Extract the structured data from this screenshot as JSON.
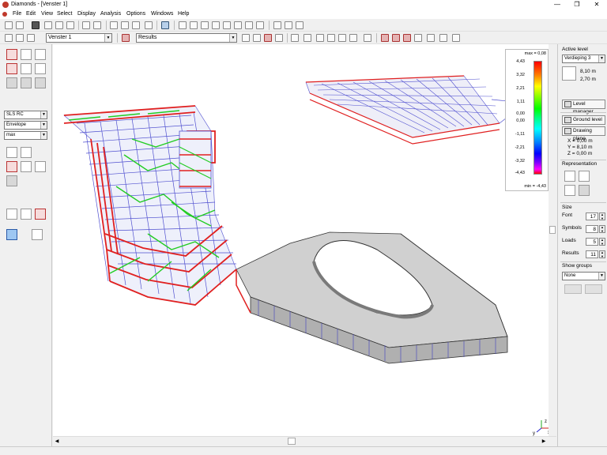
{
  "window": {
    "title": "Diamonds - [Venster 1]",
    "controls": [
      "—",
      "❐",
      "✕"
    ]
  },
  "menu": [
    "File",
    "Edit",
    "View",
    "Select",
    "Display",
    "Analysis",
    "Options",
    "Windows",
    "Help"
  ],
  "toolbar2": {
    "view_combo": "Venster 1",
    "results_combo": "Results"
  },
  "left_panel": {
    "combo_code": "SLS RC",
    "combo_envelope": "Envelope",
    "combo_max": "max"
  },
  "legend": {
    "max_label": "max = 0,08",
    "min_label": "min = -4,43",
    "ticks": [
      "4,43",
      "3,32",
      "2,21",
      "1,11",
      "0,00",
      "0,00",
      "-1,11",
      "-2,21",
      "-3,32",
      "-4,43"
    ]
  },
  "right_panel": {
    "active_level_label": "Active level",
    "level_combo": "Verdieping 3",
    "level_height": "8,10 m",
    "level_spacing": "2,70 m",
    "level_manager": "Level manager",
    "ground_level": "Ground level",
    "drawing_plane": "Drawing plane",
    "coords": {
      "x": "X =     0,00 m",
      "y": "Y =     8,10 m",
      "z": "Z =     0,00 m"
    },
    "representation_label": "Representation",
    "size_label": "Size",
    "size_rows": [
      {
        "label": "Font",
        "value": "17"
      },
      {
        "label": "Symbols",
        "value": "8"
      },
      {
        "label": "Loads",
        "value": "5"
      },
      {
        "label": "Results",
        "value": "11"
      }
    ],
    "show_groups_label": "Show groups",
    "show_groups_combo": "None"
  },
  "axis_indicator": {
    "x": "x",
    "y": "y",
    "z": "z"
  },
  "colors": {
    "beam_red": "#e02020",
    "beam_green": "#22cc22",
    "beam_blue": "#5050d0",
    "slab_grey": "#c8c8c8"
  }
}
